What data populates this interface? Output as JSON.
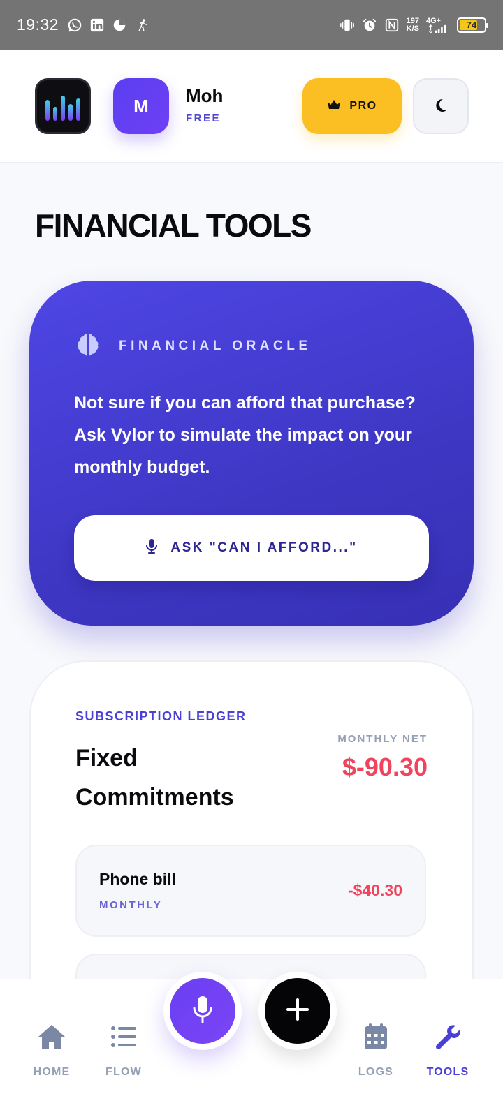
{
  "status_bar": {
    "time": "19:32",
    "speed_value": "197",
    "speed_unit": "K/S",
    "network": "4G+",
    "battery": "74",
    "battery_level": 0.74,
    "icons": [
      "whatsapp-icon",
      "linkedin-icon",
      "pie-icon",
      "running-icon",
      "vibrate-icon",
      "alarm-icon",
      "nfc-icon",
      "signal-icon",
      "battery-icon"
    ]
  },
  "header": {
    "avatar_initial": "M",
    "user_name": "Moh",
    "plan": "FREE",
    "pro_label": "PRO"
  },
  "page": {
    "title": "FINANCIAL TOOLS"
  },
  "oracle": {
    "label": "FINANCIAL ORACLE",
    "text": "Not sure if you can afford that purchase? Ask Vylor to simulate the impact on your monthly budget.",
    "button_label": "ASK \"CAN I AFFORD...\""
  },
  "ledger": {
    "kicker": "SUBSCRIPTION LEDGER",
    "title": "Fixed Commitments",
    "net_label": "MONTHLY NET",
    "net_value": "$-90.30",
    "items": [
      {
        "name": "Phone bill",
        "frequency": "MONTHLY",
        "amount": "-$40.30"
      }
    ]
  },
  "nav": {
    "home": "HOME",
    "flow": "FLOW",
    "logs": "LOGS",
    "tools": "TOOLS"
  },
  "colors": {
    "accent": "#4f46e5",
    "pro": "#fbbf24",
    "negative": "#f0445e",
    "active_nav": "#4a40d6"
  }
}
